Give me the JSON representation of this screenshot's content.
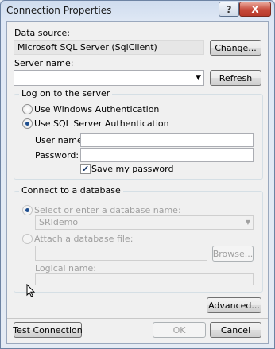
{
  "window": {
    "title": "Connection Properties",
    "help_glyph": "?",
    "close_glyph": "X"
  },
  "datasource": {
    "label": "Data source:",
    "value": "Microsoft SQL Server (SqlClient)",
    "change_label": "Change..."
  },
  "server": {
    "label": "Server name:",
    "value": "",
    "refresh_label": "Refresh"
  },
  "logon": {
    "group_label": "Log on to the server",
    "windows_auth_label": "Use Windows Authentication",
    "sql_auth_label": "Use SQL Server Authentication",
    "selected": "sql",
    "username_label": "User name:",
    "username_value": "",
    "password_label": "Password:",
    "password_value": "",
    "save_password_label": "Save my password",
    "save_password_checked": true
  },
  "database": {
    "group_label": "Connect to a database",
    "select_label": "Select or enter a database name:",
    "select_value": "SRIdemo",
    "attach_label": "Attach a database file:",
    "attach_value": "",
    "browse_label": "Browse...",
    "logical_label": "Logical name:",
    "logical_value": ""
  },
  "footer": {
    "advanced_label": "Advanced...",
    "test_label": "Test Connection",
    "ok_label": "OK",
    "cancel_label": "Cancel"
  }
}
